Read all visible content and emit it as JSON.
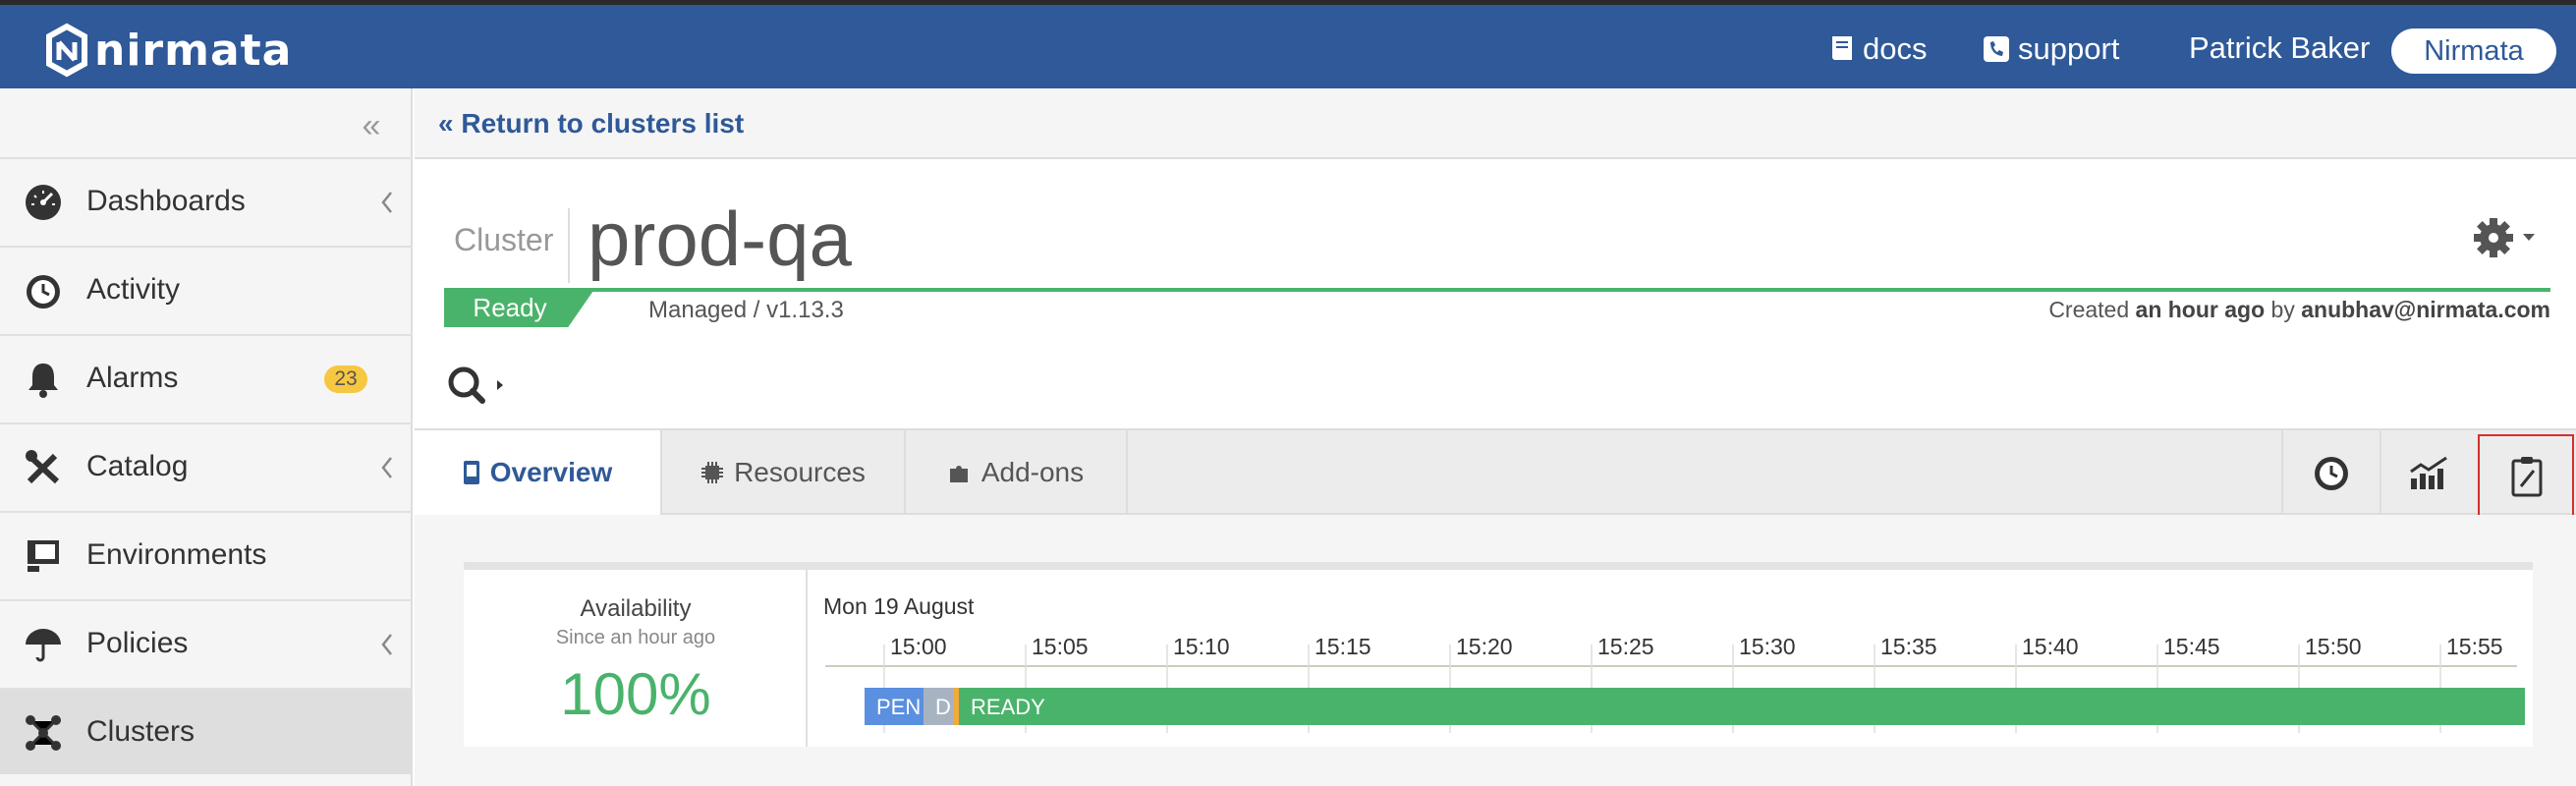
{
  "header": {
    "brand": "nirmata",
    "links": [
      {
        "label": "docs",
        "icon": "book-icon"
      },
      {
        "label": "support",
        "icon": "phone-icon"
      }
    ],
    "user_name": "Patrick Baker",
    "org": "Nirmata"
  },
  "sidebar": {
    "items": [
      {
        "label": "Dashboards",
        "icon": "dashboard-gauge-icon",
        "has_submenu": true
      },
      {
        "label": "Activity",
        "icon": "clock-icon",
        "has_submenu": false
      },
      {
        "label": "Alarms",
        "icon": "bell-icon",
        "badge": "23"
      },
      {
        "label": "Catalog",
        "icon": "tools-icon",
        "has_submenu": true
      },
      {
        "label": "Environments",
        "icon": "monitor-icon",
        "has_submenu": false
      },
      {
        "label": "Policies",
        "icon": "umbrella-icon",
        "has_submenu": true
      },
      {
        "label": "Clusters",
        "icon": "cluster-nodes-icon",
        "active": true
      }
    ]
  },
  "breadcrumb": {
    "return_label": "Return to clusters list"
  },
  "cluster": {
    "label": "Cluster",
    "name": "prod-qa",
    "status": "Ready",
    "managed": "Managed / v1.13.3",
    "created_prefix": "Created",
    "created_time": "an hour ago",
    "created_by_word": "by",
    "created_by": "anubhav@nirmata.com"
  },
  "tabs": [
    {
      "label": "Overview",
      "icon": "phone-device-icon",
      "active": true
    },
    {
      "label": "Resources",
      "icon": "chip-icon"
    },
    {
      "label": "Add-ons",
      "icon": "puzzle-icon"
    }
  ],
  "tools": [
    "history-icon",
    "chart-icon",
    "report-icon"
  ],
  "availability": {
    "title": "Availability",
    "since": "Since an hour ago",
    "value": "100%"
  },
  "timeline": {
    "date": "Mon 19 August",
    "ticks": [
      "15:00",
      "15:05",
      "15:10",
      "15:15",
      "15:20",
      "15:25",
      "15:30",
      "15:35",
      "15:40",
      "15:45",
      "15:50",
      "15:55"
    ],
    "segments": [
      {
        "label": "PEN",
        "color": "#5b8fe0"
      },
      {
        "label": "D",
        "color": "#a8b3c2"
      },
      {
        "label": "",
        "color": "#f3a93b"
      },
      {
        "label": "READY",
        "color": "#4ab36b"
      }
    ]
  },
  "colors": {
    "brand": "#2f5998",
    "ready": "#4ab36b",
    "badge": "#f6c741"
  }
}
